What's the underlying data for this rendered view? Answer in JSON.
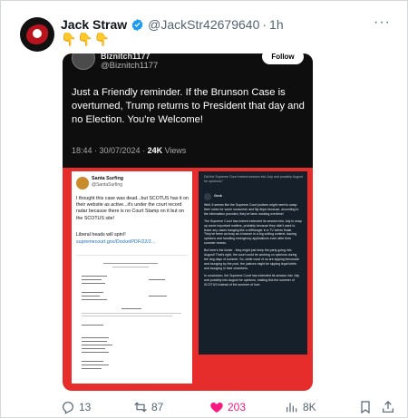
{
  "post": {
    "display_name": "Jack Straw",
    "handle": "@JackStr42679640",
    "separator": "·",
    "time": "1h",
    "text": "👇👇👇"
  },
  "quoted": {
    "name": "Biznitch1177",
    "handle": "@Biznitch1177",
    "follow_label": "Follow",
    "text": "Just a Friendly reminder. If the Brunson Case is overturned, Trump returns to President that day and no Election. You're Welcome!",
    "meta_time": "18:44 · 30/07/2024 · ",
    "meta_views": "24K",
    "meta_views_label": " Views"
  },
  "left_panel": {
    "name": "Santa Surfing",
    "handle": "@SantaSurfing",
    "text": "I thought this case was dead...but SCOTUS has it on their website as active...it's under the court record radar because there is no Court Stamp on it but on the SCOTUS site!",
    "text2": "Liberal heads will spin!!",
    "link": "supremecourt.gov/DocketPDF/22/2..."
  },
  "right_panel": {
    "question": "Did the Supreme Court extend session into July and possibly August for opinions?",
    "grok_label": "Grok",
    "paragraphs": [
      "Well, it seems like the Supreme Court justices might need to swap their robes for some sunscreen and flip-flops because, according to the information provided, they've been working overtime!",
      "The Supreme Court has indeed extended its session into July to wrap up some important matters, probably because they didn't want to leave any cases hanging like a cliffhanger in a TV series finale. They've been as busy as a beaver in a fog cutting context, issuing opinions and handling emergency applications even after their summer recess.",
      "But here's the kicker - they might just keep the party going into August! That's right, the court could be working on opinions during the dog days of summer. So, while most of us are sipping lemonade and lounging by the pool, the justices might be sipping legal briefs and lounging in their chambers.",
      "In conclusion, the Supreme Court has extended its session into July and possibly into August for opinions, making this the summer of SCOTUS instead of the summer of love."
    ]
  },
  "actions": {
    "replies": "13",
    "reposts": "87",
    "likes": "203",
    "views": "8K"
  },
  "colors": {
    "accent_blue": "#1d9bf0",
    "like_pink": "#f91880",
    "media_red": "#e72c2c"
  }
}
